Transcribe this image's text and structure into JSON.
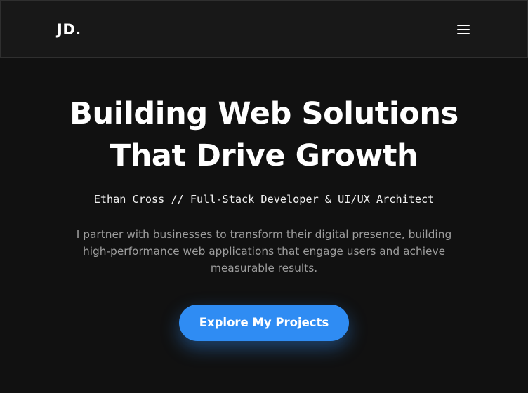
{
  "header": {
    "logo": "JD.",
    "menu_icon": "hamburger-menu-icon"
  },
  "hero": {
    "title_lines": [
      "Building Web Solutions",
      "That Drive Growth"
    ],
    "subtitle": "Ethan Cross // Full-Stack Developer & UI/UX Architect",
    "description_lines": [
      "I partner with businesses to transform their digital presence, building",
      "high-performance web applications that engage users and achieve",
      "measurable results."
    ],
    "cta_label": "Explore My Projects"
  },
  "colors": {
    "background": "#111111",
    "header_background": "#181818",
    "accent": "#2f8cf3",
    "text_primary": "#ffffff",
    "text_muted": "#9d9d9d"
  }
}
